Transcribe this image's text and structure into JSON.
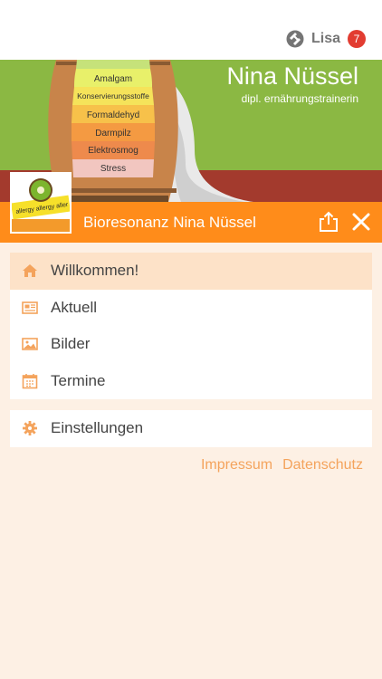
{
  "header": {
    "user_name": "Lisa",
    "notification_count": "7"
  },
  "banner": {
    "brand_name": "Nina Nüssel",
    "brand_subtitle": "dipl. ernährungstrainerin",
    "barrel_labels": [
      "Amalgam",
      "Konservierungsstoffe",
      "Formaldehyd",
      "Darmpilz",
      "Elektrosmog",
      "Stress"
    ]
  },
  "thumbnail": {
    "caption": "allergy allergy aller"
  },
  "app_bar": {
    "title": "Bioresonanz Nina Nüssel"
  },
  "menu": {
    "items": [
      {
        "label": "Willkommen!",
        "icon": "home-icon",
        "active": true
      },
      {
        "label": "Aktuell",
        "icon": "newspaper-icon"
      },
      {
        "label": "Bilder",
        "icon": "image-icon"
      },
      {
        "label": "Termine",
        "icon": "calendar-icon"
      }
    ],
    "settings": {
      "label": "Einstellungen",
      "icon": "gear-icon"
    }
  },
  "footer": {
    "impressum": "Impressum",
    "datenschutz": "Datenschutz"
  },
  "colors": {
    "accent_orange": "#ff8c1a",
    "banner_green": "#8bb843",
    "banner_red": "#a33a2d",
    "badge_red": "#e23c31",
    "menu_icon": "#f4a35c",
    "page_bg": "#fdf0e4"
  }
}
